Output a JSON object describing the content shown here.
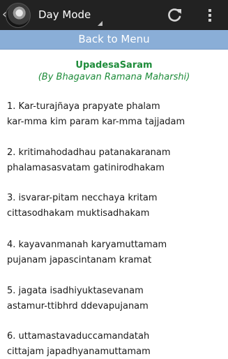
{
  "actionbar": {
    "mode_label": "Day Mode"
  },
  "nav": {
    "back_label": "Back to Menu"
  },
  "content": {
    "title": "UpadesaSaram",
    "subtitle": "(By Bhagavan Ramana Maharshi)",
    "verses": [
      {
        "line1": "1. Kar-turajñaya prapyate phalam",
        "line2": "kar-mma kim param kar-mma tajjadam"
      },
      {
        "line1": "2. kritimahodadhau patanakaranam",
        "line2": "phalamasasvatam gatinirodhakam"
      },
      {
        "line1": "3. isvarar-pitam necchaya kritam",
        "line2": "cittasodhakam muktisadhakam"
      },
      {
        "line1": "4. kayavanmanah karyamuttamam",
        "line2": "pujanam japascintanam kramat"
      },
      {
        "line1": "5. jagata isadhiyuktasevanam",
        "line2": "astamur-ttibhrd ddevapujanam"
      },
      {
        "line1": "6. uttamastavaduccamandatah",
        "line2": "cittajam japadhyanamuttamam"
      }
    ]
  },
  "colors": {
    "actionbar_bg": "#222222",
    "backbar_bg": "#8aaed7",
    "title_color": "#1e8c3a"
  },
  "icons": [
    "up-caret-icon",
    "avatar-logo",
    "refresh-icon",
    "overflow-menu-icon"
  ]
}
